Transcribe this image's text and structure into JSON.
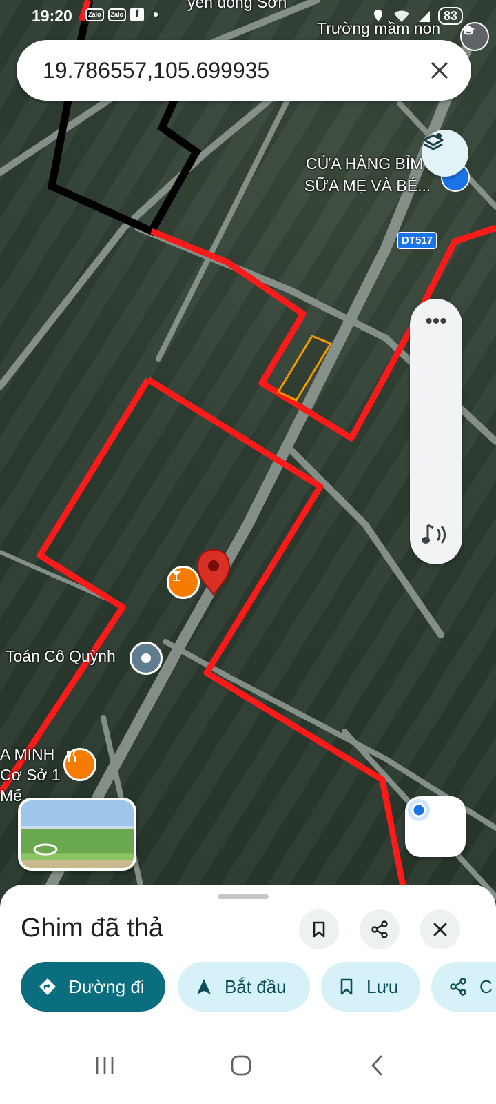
{
  "status_bar": {
    "time": "19:20",
    "apps": [
      "Zalo",
      "Zalo",
      "f"
    ],
    "battery": "83"
  },
  "search": {
    "query": "19.786557,105.699935"
  },
  "map": {
    "labels": {
      "top_place": "yên đồng Sơn",
      "kindergarten": "Trường mầm non",
      "shop_line1": "CỬA HÀNG BỈM",
      "shop_line2": "SỮA MẸ VÀ BÉ...",
      "route_shield": "DT517",
      "tutor": "Toán Cô Quỳnh",
      "restaurant_line1": "A MINH",
      "restaurant_line2": "Cơ Sở 1",
      "cut_label": "Mế"
    },
    "colors": {
      "boundary_red": "#ff1a1a",
      "boundary_black": "#000000",
      "parcel_orange": "#f29900",
      "pin_red": "#d93025",
      "poi_orange": "#f57c00",
      "road": "#8e9891"
    }
  },
  "sheet": {
    "title": "Ghim đã thả",
    "actions": {
      "directions": "Đường đi",
      "start": "Bắt đầu",
      "save": "Lưu",
      "share": "C"
    }
  }
}
